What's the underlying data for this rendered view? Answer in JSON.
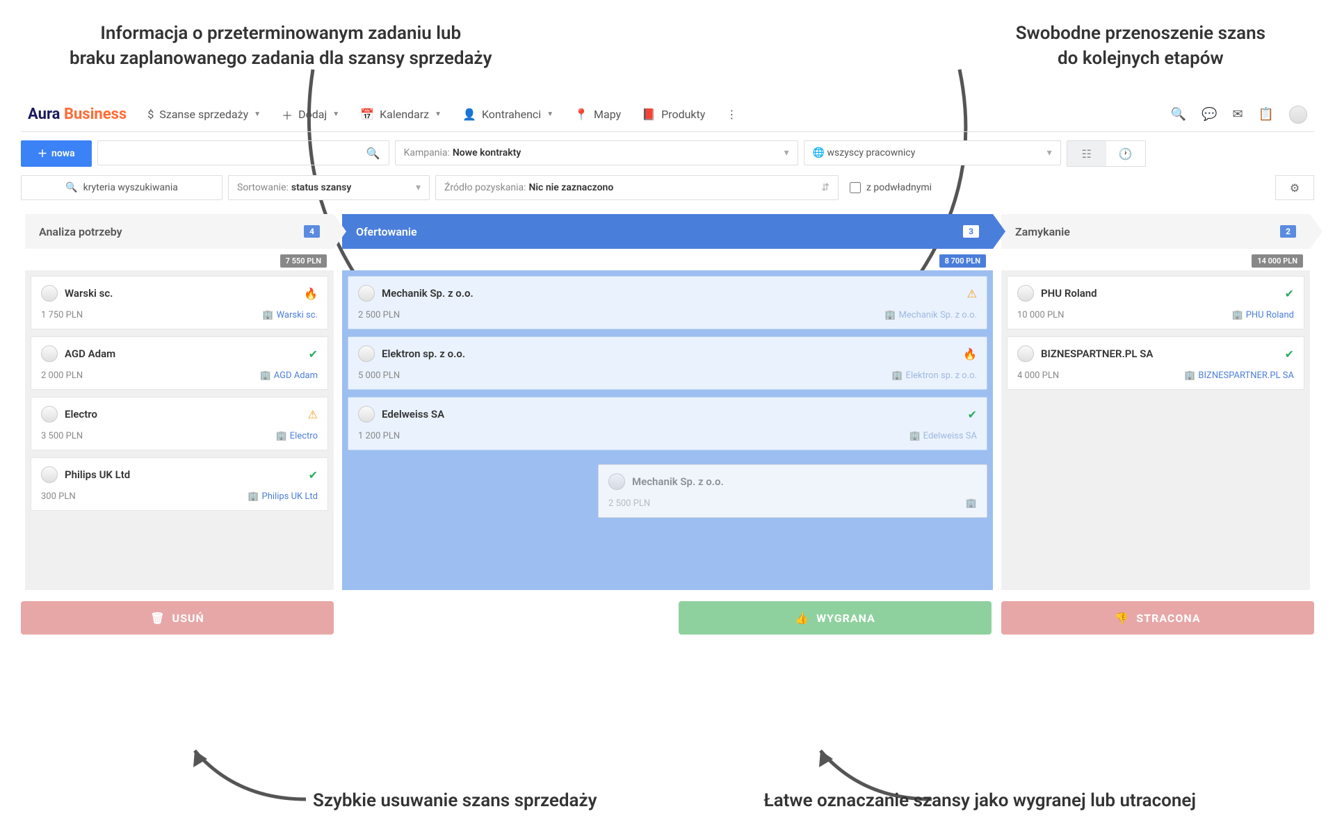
{
  "annotations": {
    "top_left": "Informacja o przeterminowanym zadaniu lub\nbraku zaplanowanego zadania dla szansy sprzedaży",
    "top_right": "Swobodne przenoszenie szans\ndo kolejnych etapów",
    "bottom_left": "Szybkie usuwanie\nszans sprzedaży",
    "bottom_right": "Łatwe oznaczanie szansy jako\nwygranej lub utraconej"
  },
  "logo": {
    "part1": "Aura",
    "part2": "Business"
  },
  "nav": {
    "szanse": "Szanse sprzedaży",
    "dodaj": "Dodaj",
    "kalendarz": "Kalendarz",
    "kontrahenci": "Kontrahenci",
    "mapy": "Mapy",
    "produkty": "Produkty"
  },
  "filters": {
    "new_btn": "nowa",
    "kryteria": "kryteria wyszukiwania",
    "sort_label": "Sortowanie:",
    "sort_value": "status szansy",
    "kampania_label": "Kampania:",
    "kampania_value": "Nowe kontrakty",
    "zrodlo_label": "Źródło pozyskania:",
    "zrodlo_value": "Nic nie zaznaczono",
    "pracownicy": "wszyscy pracownicy",
    "podwladni": "z podwładnymi"
  },
  "columns": [
    {
      "title": "Analiza potrzeby",
      "count": "4",
      "sum": "7 550 PLN",
      "active": false,
      "cards": [
        {
          "title": "Warski sc.",
          "amount": "1 750 PLN",
          "company": "Warski sc.",
          "icon": "fire"
        },
        {
          "title": "AGD Adam",
          "amount": "2 000 PLN",
          "company": "AGD Adam",
          "icon": "check"
        },
        {
          "title": "Electro",
          "amount": "3 500 PLN",
          "company": "Electro",
          "icon": "warn"
        },
        {
          "title": "Philips UK Ltd",
          "amount": "300 PLN",
          "company": "Philips UK Ltd",
          "icon": "check"
        }
      ]
    },
    {
      "title": "Ofertowanie",
      "count": "3",
      "sum": "8 700 PLN",
      "active": true,
      "cards": [
        {
          "title": "Mechanik Sp. z o.o.",
          "amount": "2 500 PLN",
          "company": "Mechanik Sp. z o.o.",
          "icon": "warn",
          "highlight": true
        },
        {
          "title": "Elektron sp. z o.o.",
          "amount": "5 000 PLN",
          "company": "Elektron sp. z o.o.",
          "icon": "fire",
          "highlight": true
        },
        {
          "title": "Edelweiss SA",
          "amount": "1 200 PLN",
          "company": "Edelweiss SA",
          "icon": "check",
          "highlight": true
        }
      ],
      "dragging": {
        "title": "Mechanik Sp. z o.o.",
        "amount": "2 500 PLN"
      }
    },
    {
      "title": "Zamykanie",
      "count": "2",
      "sum": "14 000 PLN",
      "active": false,
      "cards": [
        {
          "title": "PHU Roland",
          "amount": "10 000 PLN",
          "company": "PHU Roland",
          "icon": "check"
        },
        {
          "title": "BIZNESPARTNER.PL SA",
          "amount": "4 000 PLN",
          "company": "BIZNESPARTNER.PL SA",
          "icon": "check"
        }
      ]
    }
  ],
  "actions": {
    "delete": "USUŃ",
    "won": "WYGRANA",
    "lost": "STRACONA"
  }
}
